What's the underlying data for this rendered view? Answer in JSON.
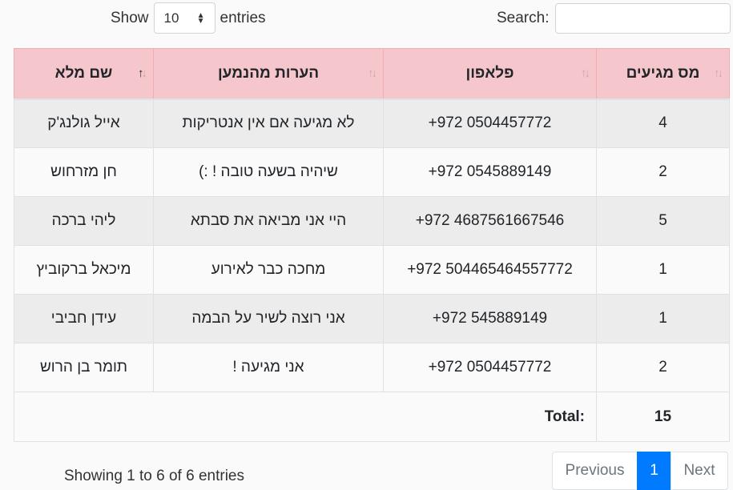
{
  "length": {
    "show_label": "Show",
    "value": "10",
    "entries_label": "entries"
  },
  "search": {
    "label": "Search:",
    "value": ""
  },
  "table": {
    "columns": [
      {
        "key": "name",
        "label": "שם מלא",
        "sorted": "asc"
      },
      {
        "key": "notes",
        "label": "הערות מהנמען",
        "sorted": "none"
      },
      {
        "key": "phone",
        "label": "פלאפון",
        "sorted": "none"
      },
      {
        "key": "count",
        "label": "מס מגיעים",
        "sorted": "none"
      }
    ],
    "rows": [
      {
        "name": "אייל גולנג'ק",
        "notes": "לא מגיעה אם אין אנטריקות",
        "phone": "+972 0504457772",
        "count": "4"
      },
      {
        "name": "חן מזרחוש",
        "notes": "שיהיה בשעה טובה ! :)",
        "phone": "+972 0545889149",
        "count": "2"
      },
      {
        "name": "ליהי ברכה",
        "notes": "היי אני מביאה את סבתא",
        "phone": "+972 4687561667546",
        "count": "5"
      },
      {
        "name": "מיכאל ברקוביץ",
        "notes": "מחכה כבר לאירוע",
        "phone": "+972 504465464557772",
        "count": "1"
      },
      {
        "name": "עידן חביבי",
        "notes": "אני רוצה לשיר על הבמה",
        "phone": "+972 545889149",
        "count": "1"
      },
      {
        "name": "תומר בן הרוש",
        "notes": "אני מגיעה !",
        "phone": "+972 0504457772",
        "count": "2"
      }
    ],
    "footer": {
      "total_label": "Total:",
      "total_value": "15"
    }
  },
  "info": "Showing 1 to 6 of 6 entries",
  "pagination": {
    "previous": "Previous",
    "current": "1",
    "next": "Next"
  },
  "colors": {
    "header_bg": "#f5c6cb",
    "active_page": "#007bff",
    "odd_row": "#ececec"
  }
}
